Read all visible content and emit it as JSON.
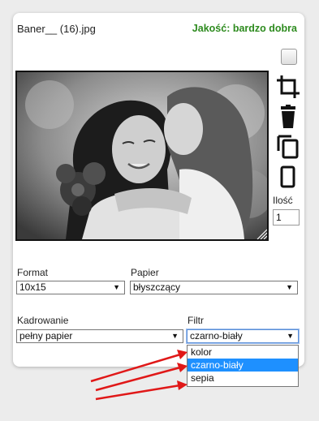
{
  "item": {
    "filename": "Baner__ (16).jpg",
    "quality": "Jakość: bardzo dobra"
  },
  "tools": {
    "quantity_label": "Ilość",
    "quantity_value": "1"
  },
  "format": {
    "label": "Format",
    "value": "10x15"
  },
  "paper": {
    "label": "Papier",
    "value": "błyszczący"
  },
  "crop": {
    "label": "Kadrowanie",
    "value": "pełny papier"
  },
  "filter": {
    "label": "Filtr",
    "value": "czarno-biały",
    "options": [
      "kolor",
      "czarno-biały",
      "sepia"
    ],
    "highlighted": "czarno-biały"
  },
  "colors": {
    "quality_green": "#2e8b1f",
    "highlight_blue": "#1e90ff",
    "annotation_arrow": "#e01818"
  }
}
